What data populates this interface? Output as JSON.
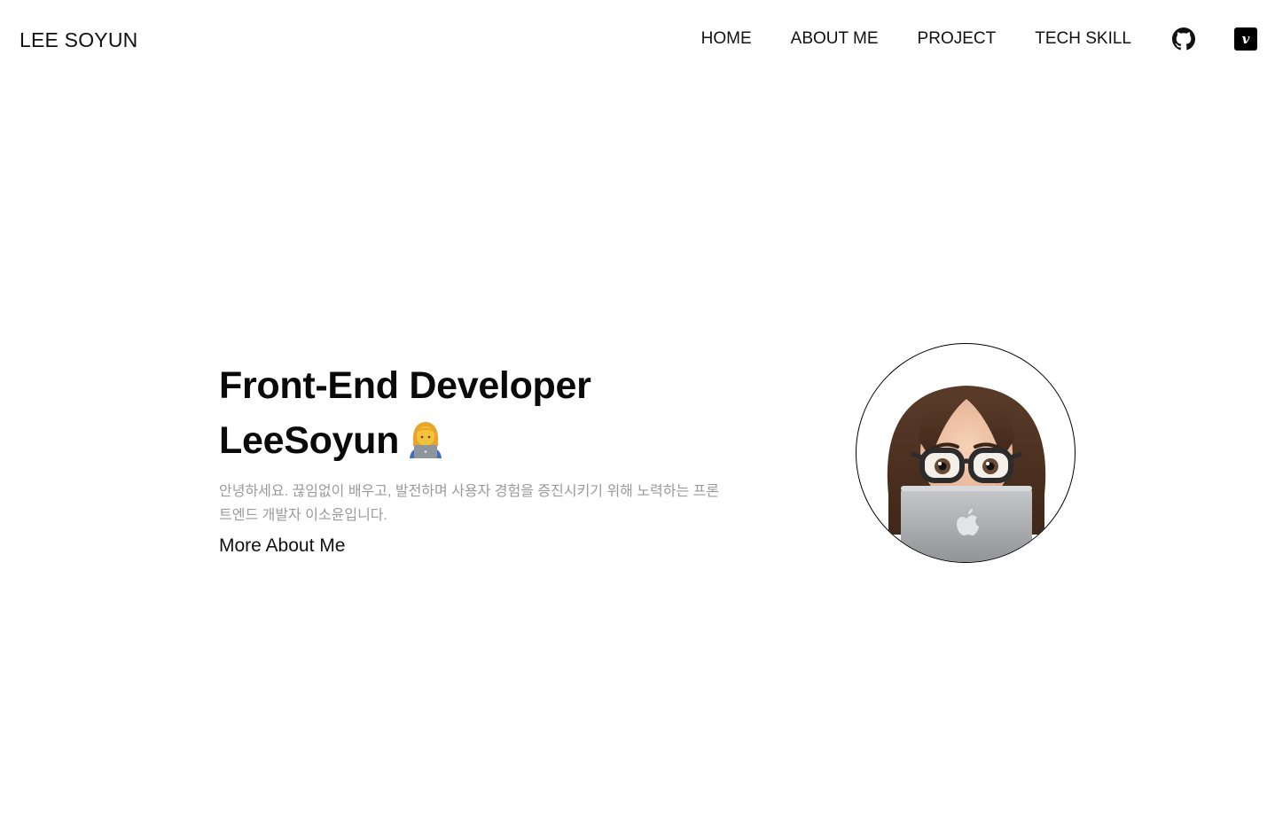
{
  "header": {
    "logo": "LEE SOYUN",
    "nav": [
      "HOME",
      "ABOUT ME",
      "PROJECT",
      "TECH SKILL"
    ],
    "icons": {
      "github": "github-icon",
      "vimeo": "vimeo-icon",
      "vimeo_glyph": "v"
    }
  },
  "hero": {
    "title_line1": "Front-End Developer",
    "title_line2": "LeeSoyun",
    "emoji": "woman-technologist-emoji",
    "description": "안녕하세요. 끊임없이 배우고, 발전하며 사용자 경험을 증진시키기 위해 노력하는 프론트엔드 개발자 이소윤입니다.",
    "more_link": "More About Me",
    "avatar": "memoji-avatar-with-laptop"
  },
  "colors": {
    "text": "#111111",
    "muted": "#9a9a9a",
    "background": "#ffffff"
  }
}
